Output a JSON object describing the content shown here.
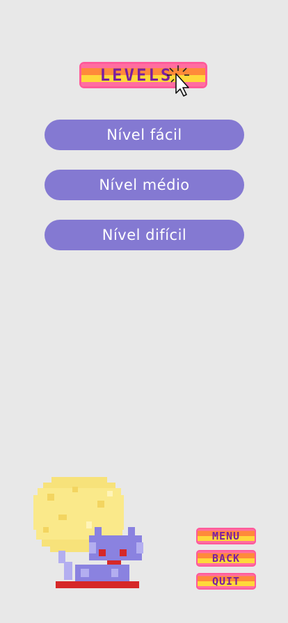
{
  "title": {
    "text": "LEVELS"
  },
  "levels": [
    {
      "label": "Nível fácil"
    },
    {
      "label": "Nível médio"
    },
    {
      "label": "Nível difícil"
    }
  ],
  "nav": {
    "menu": "MENU",
    "back": "BACK",
    "quit": "QUIT"
  },
  "colors": {
    "background": "#e8e8e8",
    "level_button": "#8479d2",
    "badge_text": "#7a1fa0"
  },
  "icons": {
    "cursor": "pointer-cursor-icon",
    "mascot": "cat-moon-illustration"
  }
}
